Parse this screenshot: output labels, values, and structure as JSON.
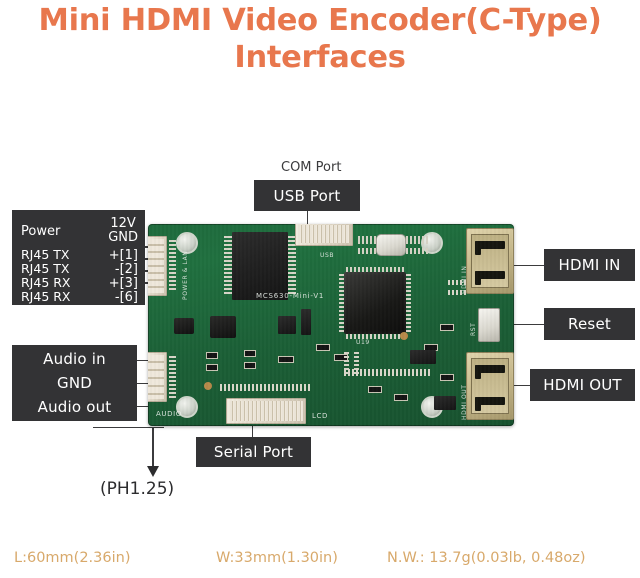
{
  "title": {
    "line1": "Mini HDMI Video Encoder(C-Type)",
    "line2": "Interfaces",
    "color": "#e8774d"
  },
  "callouts": {
    "com_port": "COM Port",
    "usb_port": "USB Port",
    "hdmi_in": "HDMI IN",
    "reset": "Reset",
    "hdmi_out": "HDMI OUT",
    "audio_in": "Audio in",
    "gnd": "GND",
    "audio_out": "Audio out",
    "serial_port": "Serial Port",
    "ph_note": "(PH1.25)"
  },
  "power_block": {
    "label": "Power",
    "v12": "12V",
    "gnd": "GND",
    "rows": [
      {
        "left": "RJ45 TX",
        "right": "+[1]"
      },
      {
        "left": "RJ45 TX",
        "right": "-[2]"
      },
      {
        "left": "RJ45 RX",
        "right": "+[3]"
      },
      {
        "left": "RJ45 RX",
        "right": "-[6]"
      }
    ]
  },
  "pcb": {
    "silkscreen": {
      "power_lan": "POWER & LAN",
      "model": "MCS630-Mini-V1",
      "usb": "USB",
      "audio": "AUDIO",
      "lcd": "LCD",
      "hdmi_out": "HDMI OUT",
      "hdmi_in": "HDMI IN",
      "u19": "U19",
      "rst": "RST"
    },
    "board_color": "#1b6238"
  },
  "specs": {
    "length": "L:60mm(2.36in)",
    "width": "W:33mm(1.30in)",
    "weight": "N.W.: 13.7g(0.03lb, 0.48oz)",
    "color": "#d8a96b"
  }
}
